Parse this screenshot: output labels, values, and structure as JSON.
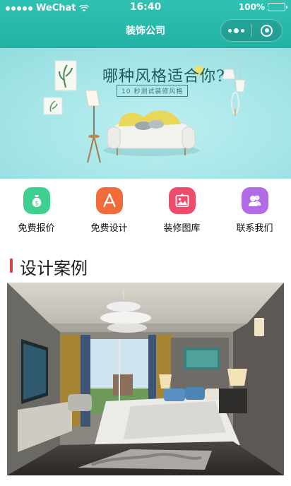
{
  "status_bar": {
    "carrier": "WeChat",
    "time": "16:40",
    "battery": "100%"
  },
  "navbar": {
    "title": "装饰公司"
  },
  "banner": {
    "headline": "哪种风格适合你?",
    "subline": "10 秒测试装修风格"
  },
  "menu": [
    {
      "label": "免费报价",
      "icon": "money-bag-icon",
      "color": "#3fcf8e"
    },
    {
      "label": "免费设计",
      "icon": "design-app-icon",
      "color": "#f26b3a"
    },
    {
      "label": "装修图库",
      "icon": "picture-gallery-icon",
      "color": "#ef4b6a"
    },
    {
      "label": "联系我们",
      "icon": "contacts-icon",
      "color": "#b36ae6"
    }
  ],
  "section": {
    "title": "设计案例"
  },
  "colors": {
    "header": "#22b2a4",
    "accent_bar": "#d64545",
    "banner_bg": "#a6e6e8"
  }
}
